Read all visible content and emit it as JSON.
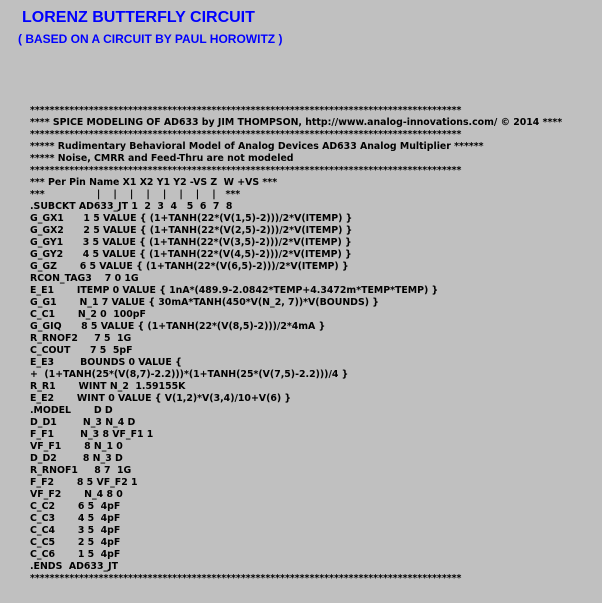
{
  "header": {
    "title": "LORENZ BUTTERFLY CIRCUIT",
    "subtitle": "( BASED ON A CIRCUIT BY PAUL HOROWITZ )"
  },
  "netlist": [
    "****************************************************************************************",
    "**** SPICE MODELING OF AD633 by JIM THOMPSON, http://www.analog-innovations.com/ © 2014 ****",
    "****************************************************************************************",
    "***** Rudimentary Behavioral Model of Analog Devices AD633 Analog Multiplier ******",
    "***** Noise, CMRR and Feed-Thru are not modeled",
    "****************************************************************************************",
    "*** Per Pin Name X1 X2 Y1 Y2 -VS Z  W +VS ***",
    "***                |    |    |    |    |    |    |    |   ***",
    ".SUBCKT AD633_JT 1  2  3  4   5  6  7  8",
    "G_GX1      1 5 VALUE { (1+TANH(22*(V(1,5)-2)))/2*V(ITEMP) }",
    "G_GX2      2 5 VALUE { (1+TANH(22*(V(2,5)-2)))/2*V(ITEMP) }",
    "G_GY1      3 5 VALUE { (1+TANH(22*(V(3,5)-2)))/2*V(ITEMP) }",
    "G_GY2      4 5 VALUE { (1+TANH(22*(V(4,5)-2)))/2*V(ITEMP) }",
    "G_GZ       6 5 VALUE { (1+TANH(22*(V(6,5)-2)))/2*V(ITEMP) }",
    "RCON_TAG3    7 0 1G",
    "E_E1       ITEMP 0 VALUE { 1nA*(489.9-2.0842*TEMP+4.3472m*TEMP*TEMP) }",
    "G_G1       N_1 7 VALUE { 30mA*TANH(450*V(N_2, 7))*V(BOUNDS) }",
    "C_C1       N_2 0  100pF",
    "G_GIQ      8 5 VALUE { (1+TANH(22*(V(8,5)-2)))/2*4mA }",
    "R_RNOF2     7 5  1G",
    "C_COUT      7 5  5pF",
    "E_E3        BOUNDS 0 VALUE {",
    "+  (1+TANH(25*(V(8,7)-2.2)))*(1+TANH(25*(V(7,5)-2.2)))/4 }",
    "R_R1       WINT N_2  1.59155K",
    "E_E2       WINT 0 VALUE { V(1,2)*V(3,4)/10+V(6) }",
    ".MODEL       D D",
    "D_D1        N_3 N_4 D",
    "F_F1        N_3 8 VF_F1 1",
    "VF_F1       8 N_1 0",
    "D_D2        8 N_3 D",
    "R_RNOF1     8 7  1G",
    "F_F2       8 5 VF_F2 1",
    "VF_F2       N_4 8 0",
    "C_C2       6 5  4pF",
    "C_C3       4 5  4pF",
    "C_C4       3 5  4pF",
    "C_C5       2 5  4pF",
    "C_C6       1 5  4pF",
    ".ENDS  AD633_JT",
    "****************************************************************************************"
  ]
}
